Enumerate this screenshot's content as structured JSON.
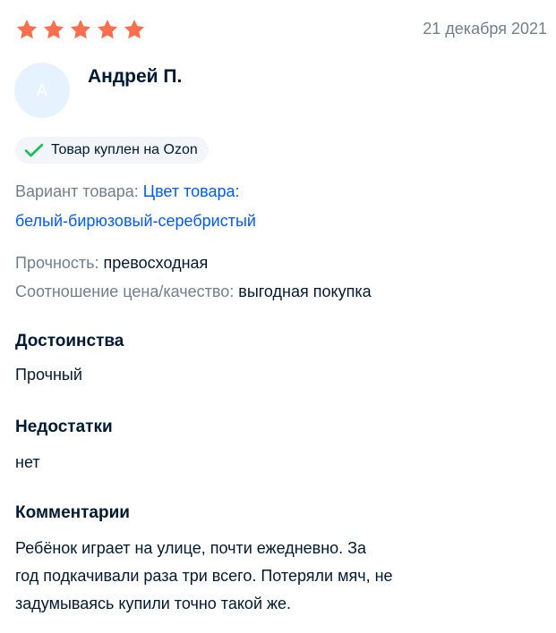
{
  "review": {
    "rating": 5,
    "star_color": "#f96e4e",
    "date": "21 декабря 2021",
    "author": {
      "initial": "А",
      "name": "Андрей П."
    },
    "verified_badge": {
      "icon": "check-icon",
      "check_color": "#10c44c",
      "label": "Товар куплен на Ozon"
    },
    "variant": {
      "label": "Вариант товара:",
      "value_line1": "Цвет товара:",
      "value_line2": "белый-бирюзовый-серебристый"
    },
    "properties": [
      {
        "label": "Прочность:",
        "value": "превосходная"
      },
      {
        "label": "Соотношение цена/качество:",
        "value": "выгодная покупка"
      }
    ],
    "sections": {
      "pros": {
        "title": "Достоинства",
        "text": "Прочный"
      },
      "cons": {
        "title": "Недостатки",
        "text": "нет"
      },
      "comments": {
        "title": "Комментарии",
        "lines": [
          "Ребёнок играет на улице, почти ежедневно. За",
          "год подкачивали раза три всего. Потеряли мяч, не",
          "задумываясь купили точно такой же."
        ]
      }
    }
  }
}
